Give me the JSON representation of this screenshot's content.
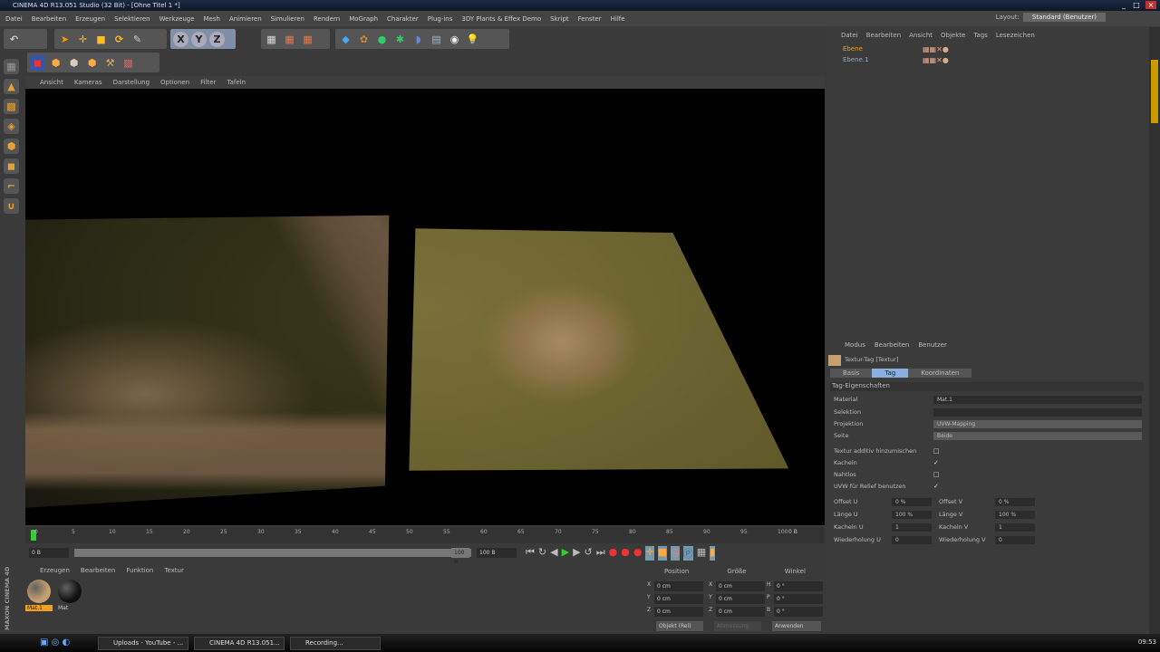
{
  "title": "CINEMA 4D R13.051 Studio (32 Bit) - [Ohne Titel 1 *]",
  "menu": [
    "Datei",
    "Bearbeiten",
    "Erzeugen",
    "Selektieren",
    "Werkzeuge",
    "Mesh",
    "Animieren",
    "Simulieren",
    "Rendern",
    "MoGraph",
    "Charakter",
    "Plug-ins",
    "3DY Plants & Effex Demo",
    "Skript",
    "Fenster",
    "Hilfe"
  ],
  "layout": {
    "label": "Layout:",
    "value": "Standard (Benutzer)"
  },
  "toolbar": {
    "axes": [
      "X",
      "Y",
      "Z"
    ]
  },
  "viewport_menu": [
    "Ansicht",
    "Kameras",
    "Darstellung",
    "Optionen",
    "Filter",
    "Tafeln"
  ],
  "timeline": {
    "ticks": [
      "0",
      "5",
      "10",
      "15",
      "20",
      "25",
      "30",
      "35",
      "40",
      "45",
      "50",
      "55",
      "60",
      "65",
      "70",
      "75",
      "80",
      "85",
      "90",
      "95",
      "100"
    ],
    "end_label": "0 B",
    "start_field": "0 B",
    "current_field": "100 B",
    "max_field": "100 B"
  },
  "material_manager": {
    "menu": [
      "Erzeugen",
      "Bearbeiten",
      "Funktion",
      "Textur"
    ],
    "materials": [
      {
        "name": "Mat.1",
        "color": "#c8a070"
      },
      {
        "name": "Mat",
        "color": "#111111"
      }
    ]
  },
  "coordinates": {
    "headers": [
      "Position",
      "Größe",
      "Winkel"
    ],
    "rows": [
      {
        "axis": "X",
        "pos": "0 cm",
        "sizeaxis": "X",
        "size": "0 cm",
        "angaxis": "H",
        "ang": "0 °"
      },
      {
        "axis": "Y",
        "pos": "0 cm",
        "sizeaxis": "Y",
        "size": "0 cm",
        "angaxis": "P",
        "ang": "0 °"
      },
      {
        "axis": "Z",
        "pos": "0 cm",
        "sizeaxis": "Z",
        "size": "0 cm",
        "angaxis": "B",
        "ang": "0 °"
      }
    ],
    "mode": "Objekt (Rel)",
    "size_mode": "Abmessung",
    "apply": "Anwenden"
  },
  "object_manager": {
    "menu": [
      "Datei",
      "Bearbeiten",
      "Ansicht",
      "Objekte",
      "Tags",
      "Lesezeichen"
    ],
    "objects": [
      "Ebene",
      "Ebene.1"
    ]
  },
  "attributes": {
    "menu": [
      "Modus",
      "Bearbeiten",
      "Benutzer"
    ],
    "title": "Textur-Tag [Textur]",
    "tabs": [
      "Basis",
      "Tag",
      "Koordinaten"
    ],
    "section": "Tag-Eigenschaften",
    "material_label": "Material",
    "material_value": "Mat.1",
    "selection_label": "Selektion",
    "projection_label": "Projektion",
    "projection_value": "UVW-Mapping",
    "side_label": "Seite",
    "side_value": "Beide",
    "checks": [
      {
        "label": "Textur additiv hinzumischen",
        "checked": false
      },
      {
        "label": "Kacheln",
        "checked": true
      },
      {
        "label": "Nahtlos",
        "checked": false
      },
      {
        "label": "UVW für Relief benutzen",
        "checked": true
      }
    ],
    "params": [
      {
        "l": "Offset U",
        "v": "0 %",
        "l2": "Offset V",
        "v2": "0 %"
      },
      {
        "l": "Länge U",
        "v": "100 %",
        "l2": "Länge V",
        "v2": "100 %"
      },
      {
        "l": "Kacheln U",
        "v": "1",
        "l2": "Kacheln V",
        "v2": "1"
      },
      {
        "l": "Wiederholung U",
        "v": "0",
        "l2": "Wiederholung V",
        "v2": "0"
      }
    ]
  },
  "taskbar": {
    "tasks": [
      "Uploads - YouTube - ...",
      "CINEMA 4D R13.051...",
      "Recording..."
    ],
    "clock": "09:53"
  },
  "brand": "MAXON CINEMA 4D"
}
